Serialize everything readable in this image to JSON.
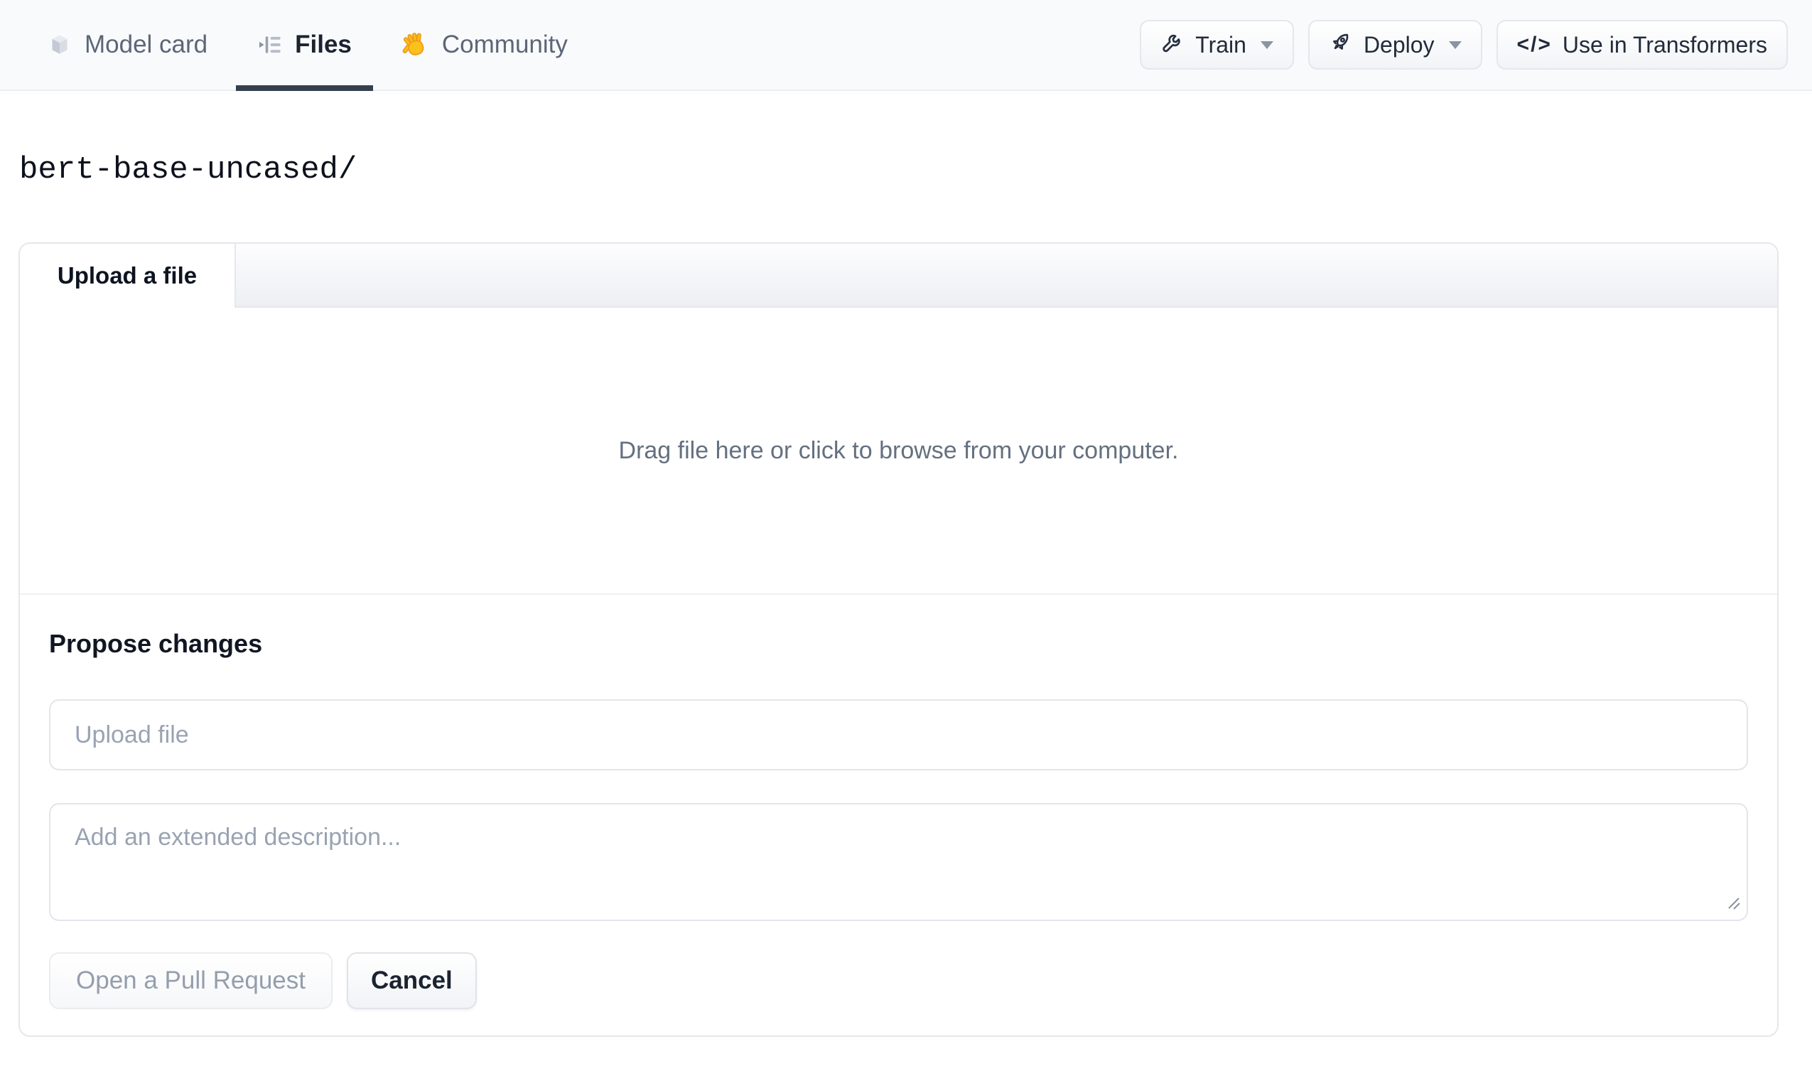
{
  "header": {
    "tabs": [
      {
        "label": "Model card",
        "icon": "cube-icon",
        "active": false
      },
      {
        "label": "Files",
        "icon": "files-list-icon",
        "active": true
      },
      {
        "label": "Community",
        "icon": "waving-hand-icon",
        "active": false
      }
    ],
    "actions": [
      {
        "label": "Train",
        "icon": "wrench-icon",
        "has_caret": true
      },
      {
        "label": "Deploy",
        "icon": "rocket-icon",
        "has_caret": true
      },
      {
        "label": "Use in Transformers",
        "icon": "code-icon",
        "has_caret": false
      }
    ]
  },
  "breadcrumb": {
    "path": "bert-base-uncased/"
  },
  "upload_card": {
    "tab_label": "Upload a file",
    "dropzone_text": "Drag file here or click to browse from your computer.",
    "propose": {
      "heading": "Propose changes",
      "filename_placeholder": "Upload file",
      "description_placeholder": "Add an extended description...",
      "primary_button": "Open a Pull Request",
      "cancel_button": "Cancel"
    }
  },
  "colors": {
    "header_bg": "#f8fafc",
    "active_tab_underline": "#343f4f",
    "card_border": "#e5e7eb",
    "muted_text": "#64707f",
    "placeholder_text": "#99a3b2",
    "disabled_button_text": "#949eac",
    "hand_emoji_fill": "#fcc21c"
  }
}
